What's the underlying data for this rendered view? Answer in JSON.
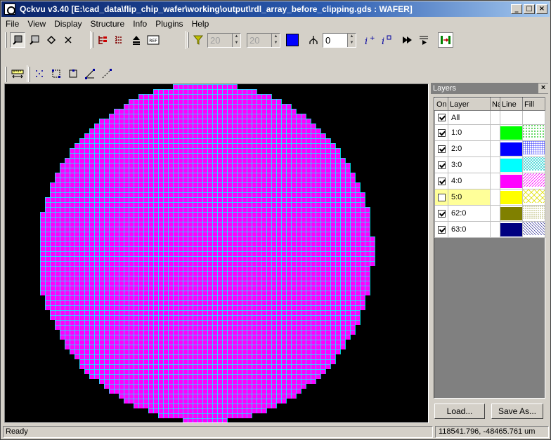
{
  "window": {
    "title": "Qckvu v3.40 [E:\\cad_data\\flip_chip_wafer\\working\\output\\rdl_array_before_clipping.gds : WAFER]",
    "minimize": "_",
    "maximize": "□",
    "close": "×"
  },
  "menu": {
    "items": [
      "File",
      "View",
      "Display",
      "Structure",
      "Info",
      "Plugins",
      "Help"
    ]
  },
  "toolbar": {
    "spin1": "20",
    "spin2": "20",
    "spin3": "0",
    "ref_label": "REF",
    "highlight_color": "#0000ff"
  },
  "layers_panel": {
    "title": "Layers",
    "close": "×",
    "headers": [
      "On",
      "Layer",
      "Na",
      "Line",
      "Fill"
    ],
    "rows": [
      {
        "name": "All",
        "on": true,
        "color": ""
      },
      {
        "name": "1:0",
        "on": true,
        "color": "#00ff00"
      },
      {
        "name": "2:0",
        "on": true,
        "color": "#0000ff"
      },
      {
        "name": "3:0",
        "on": true,
        "color": "#00ffff"
      },
      {
        "name": "4:0",
        "on": true,
        "color": "#ff00ff"
      },
      {
        "name": "5:0",
        "on": false,
        "color": "#ffff00"
      },
      {
        "name": "62:0",
        "on": true,
        "color": "#808000"
      },
      {
        "name": "63:0",
        "on": true,
        "color": "#000080"
      }
    ],
    "load_label": "Load...",
    "save_label": "Save As..."
  },
  "status": {
    "text": "Ready",
    "coords": "118541.796, -48465.761 um"
  },
  "wafer": {
    "die_color": "#ff00ff",
    "grid_color": "#00ffff",
    "background": "#000000"
  }
}
